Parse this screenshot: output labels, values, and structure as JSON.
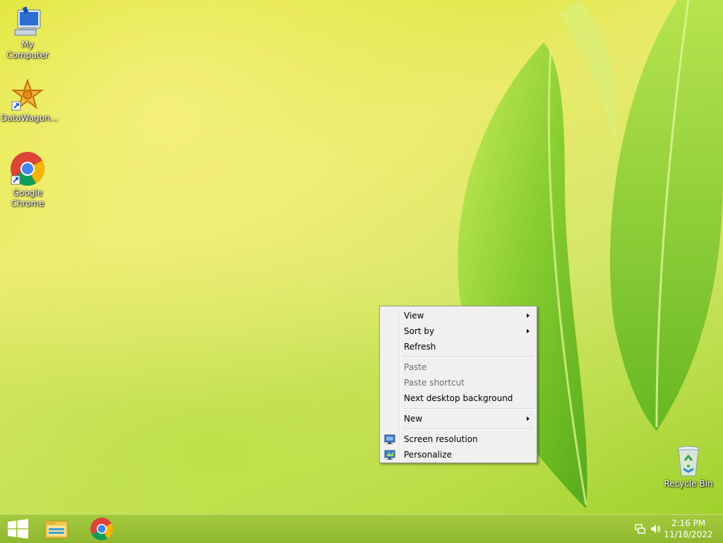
{
  "desktop": {
    "icons": [
      {
        "label": "My Computer"
      },
      {
        "label": "DataWagon..."
      },
      {
        "label": "Google Chrome"
      },
      {
        "label": "Recycle Bin"
      }
    ]
  },
  "context_menu": {
    "items": [
      {
        "label": "View",
        "submenu": true
      },
      {
        "label": "Sort by",
        "submenu": true
      },
      {
        "label": "Refresh"
      },
      {
        "label": "Paste",
        "disabled": true
      },
      {
        "label": "Paste shortcut",
        "disabled": true
      },
      {
        "label": "Next desktop background"
      },
      {
        "label": "New",
        "submenu": true
      },
      {
        "label": "Screen resolution",
        "icon": "screen-resolution-icon"
      },
      {
        "label": "Personalize",
        "icon": "personalize-icon"
      }
    ]
  },
  "taskbar": {
    "start_icon": "windows-logo-icon",
    "pinned": [
      {
        "icon": "file-explorer-icon"
      },
      {
        "icon": "chrome-icon"
      }
    ],
    "tray_icons": [
      "network-icon",
      "volume-icon"
    ],
    "clock": {
      "time": "2:16 PM",
      "date": "11/18/2022"
    }
  },
  "colors": {
    "taskbar": "#98c035",
    "menu_background": "#f0f0f0"
  }
}
